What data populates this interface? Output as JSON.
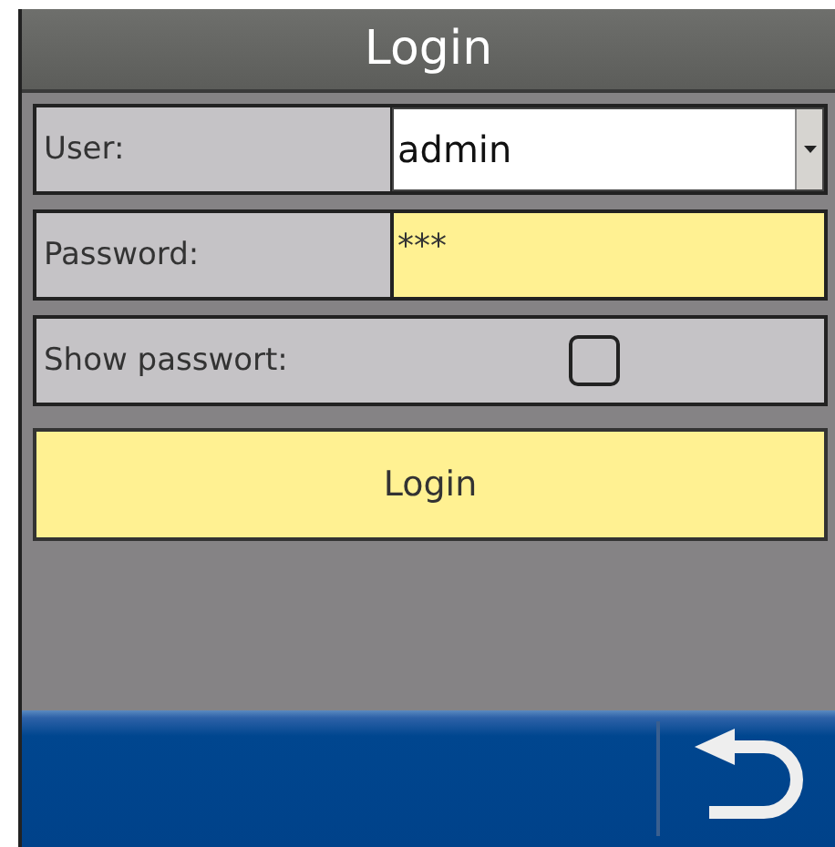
{
  "window": {
    "title": "Login"
  },
  "fields": [
    {
      "kind": "dropdown",
      "label": "User:",
      "value": "admin"
    },
    {
      "kind": "password",
      "label": "Password:",
      "value": "***"
    },
    {
      "kind": "checkbox",
      "label": "Show passwort:",
      "checked": false
    }
  ],
  "button": {
    "label": "Login"
  }
}
